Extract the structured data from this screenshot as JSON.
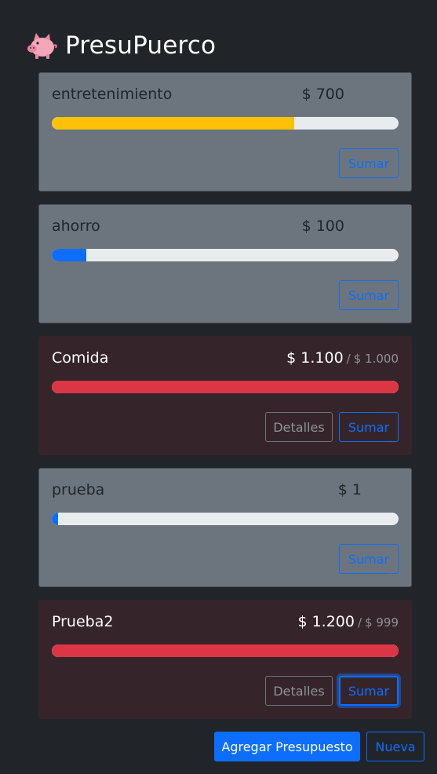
{
  "app": {
    "title": "PresuPuerco",
    "logo_icon": "pig-icon"
  },
  "colors": {
    "background": "#212529",
    "card_normal": "#6c757d",
    "card_over": "#35252a",
    "warning": "#ffc107",
    "primary": "#0d6efd",
    "danger": "#dc3545"
  },
  "budgets": [
    {
      "name": "entretenimiento",
      "amount": "$ 700",
      "limit": "",
      "progress": 0.7,
      "bar_color": "#ffc107",
      "over": false,
      "details_label": "",
      "add_label": "Sumar"
    },
    {
      "name": "ahorro",
      "amount": "$ 100",
      "limit": "",
      "progress": 0.1,
      "bar_color": "#0d6efd",
      "over": false,
      "details_label": "",
      "add_label": "Sumar"
    },
    {
      "name": "Comida",
      "amount": "$ 1.100",
      "limit": "$ 1.000",
      "progress": 1.0,
      "bar_color": "#dc3545",
      "over": true,
      "details_label": "Detalles",
      "add_label": "Sumar"
    },
    {
      "name": "prueba",
      "amount": "$ 1",
      "limit": "",
      "progress": 0.01,
      "bar_color": "#0d6efd",
      "over": false,
      "details_label": "",
      "add_label": "Sumar"
    },
    {
      "name": "Prueba2",
      "amount": "$ 1.200",
      "limit": "$ 999",
      "progress": 1.0,
      "bar_color": "#dc3545",
      "over": true,
      "details_label": "Detalles",
      "add_label": "Sumar"
    }
  ],
  "footer": {
    "add_budget_label": "Agregar Presupuesto",
    "new_label": "Nueva"
  }
}
